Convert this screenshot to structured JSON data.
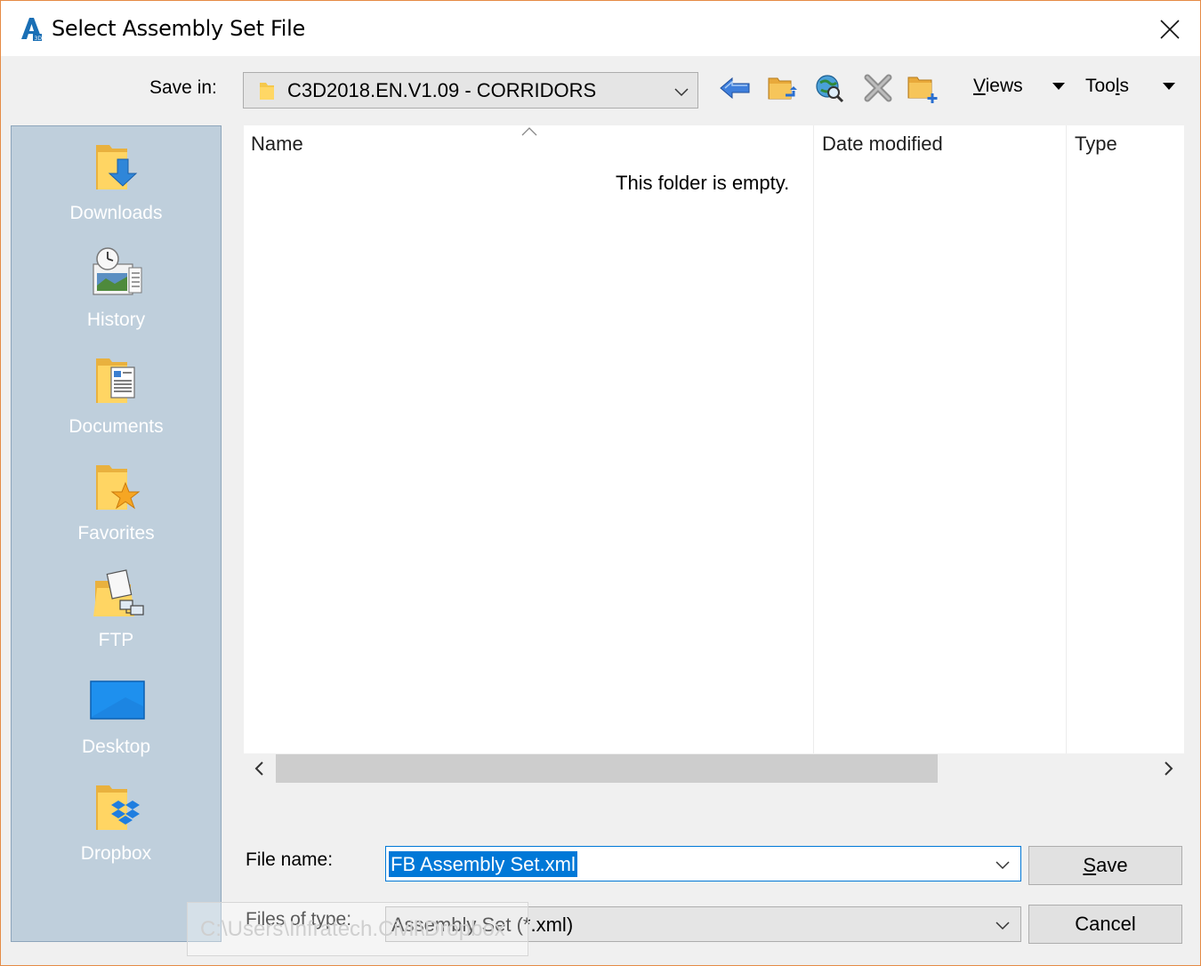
{
  "window": {
    "title": "Select Assembly Set File",
    "app_icon": "autocad-civil3d-icon"
  },
  "toolbar": {
    "save_in_label": "Save in:",
    "save_in_value": "C3D2018.EN.V1.09 - CORRIDORS",
    "buttons": [
      "back-icon",
      "up-one-level-icon",
      "search-web-icon",
      "delete-icon",
      "create-new-folder-icon"
    ],
    "views_prefix": "V",
    "views_rest": "iews",
    "tools_prefix": "Too",
    "tools_underlined": "l",
    "tools_rest": "s"
  },
  "places": [
    {
      "label": "Downloads",
      "icon": "downloads-folder-icon"
    },
    {
      "label": "History",
      "icon": "history-icon"
    },
    {
      "label": "Documents",
      "icon": "documents-folder-icon"
    },
    {
      "label": "Favorites",
      "icon": "favorites-folder-icon"
    },
    {
      "label": "FTP",
      "icon": "ftp-icon"
    },
    {
      "label": "Desktop",
      "icon": "desktop-icon"
    },
    {
      "label": "Dropbox",
      "icon": "dropbox-folder-icon"
    }
  ],
  "file_list": {
    "columns": [
      "Name",
      "Date modified",
      "Type"
    ],
    "empty_message": "This folder is empty."
  },
  "file_name": {
    "label": "File name:",
    "value": "FB Assembly Set.xml"
  },
  "file_type": {
    "label": "Files of type:",
    "value": "Assembly Set (*.xml)"
  },
  "buttons": {
    "save_underlined": "S",
    "save_rest": "ave",
    "cancel": "Cancel"
  },
  "tooltip": {
    "text": "C:\\Users\\Infratech.Civil\\Dropbox"
  },
  "colors": {
    "accent": "#0078d7",
    "window_border": "#e58b45",
    "places_bg": "#bfcfdc"
  }
}
